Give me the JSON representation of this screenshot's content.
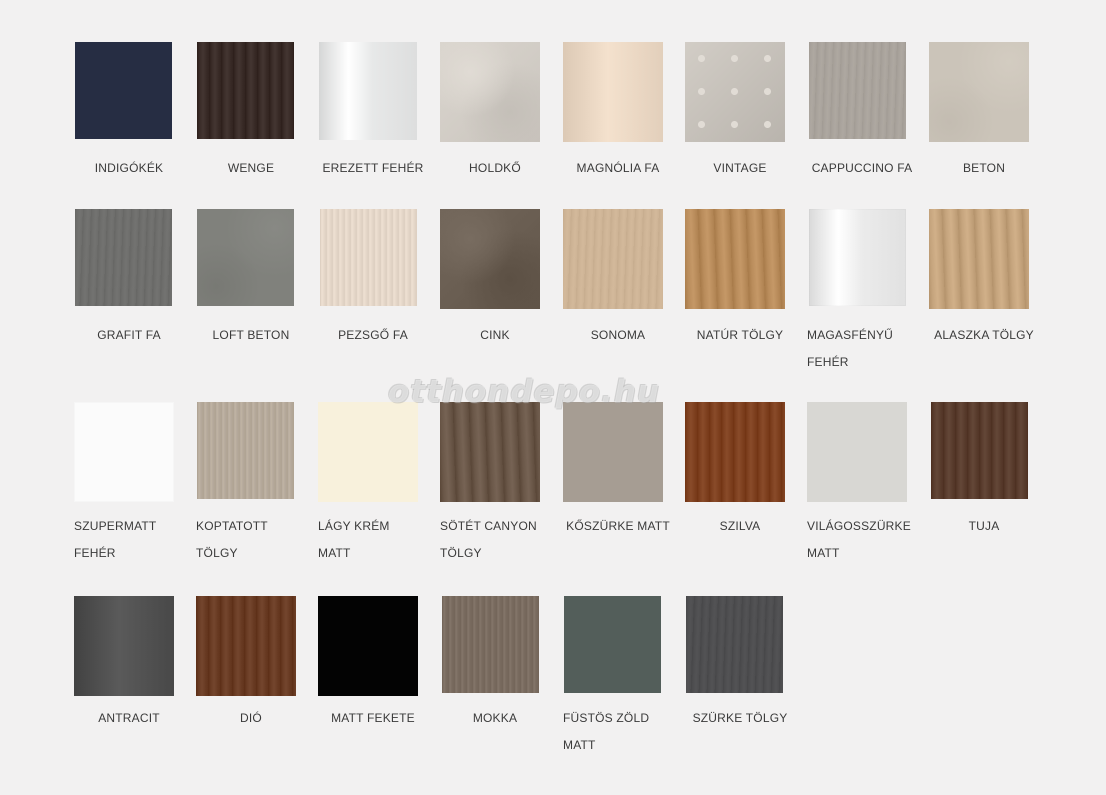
{
  "watermark": "otthondepo.hu",
  "swatches": [
    {
      "label": "INDIGÓKÉK",
      "color": "#262d43",
      "texture": "solid"
    },
    {
      "label": "WENGE",
      "color": "#3a2c28",
      "texture": "woodDark"
    },
    {
      "label": "EREZETT FEHÉR",
      "color": "#e7e8e8",
      "texture": "gloss"
    },
    {
      "label": "HOLDKŐ",
      "color": "#d2cdc6",
      "texture": "marble"
    },
    {
      "label": "MAGNÓLIA FA",
      "color": "#e8d5c1",
      "texture": "smooth"
    },
    {
      "label": "VINTAGE",
      "color": "#c8c3bc",
      "texture": "pattern"
    },
    {
      "label": "CAPPUCCINO FA",
      "color": "#a8a29b",
      "texture": "woodLight"
    },
    {
      "label": "BETON",
      "color": "#cbc4b9",
      "texture": "concrete"
    },
    {
      "label": "GRAFIT FA",
      "color": "#6d6d6b",
      "texture": "woodLight"
    },
    {
      "label": "LOFT BETON",
      "color": "#80817c",
      "texture": "concrete"
    },
    {
      "label": "PEZSGŐ FA",
      "color": "#e5d7c9",
      "texture": "woodStripe"
    },
    {
      "label": "CINK",
      "color": "#6a5e52",
      "texture": "marble"
    },
    {
      "label": "SONOMA",
      "color": "#cdb395",
      "texture": "woodLight"
    },
    {
      "label": "NATÚR TÖLGY",
      "color": "#b98c5b",
      "texture": "woodGrain"
    },
    {
      "label": "MAGASFÉNYŰ\nFEHÉR",
      "color": "#ebebeb",
      "texture": "gloss"
    },
    {
      "label": "ALASZKA TÖLGY",
      "color": "#c5a47d",
      "texture": "woodGrain"
    },
    {
      "label": "SZUPERMATT\nFEHÉR",
      "color": "#fbfbfb",
      "texture": "solid"
    },
    {
      "label": "KOPTATOTT\nTÖLGY",
      "color": "#b6aa9b",
      "texture": "woodStripe"
    },
    {
      "label": "LÁGY KRÉM\nMATT",
      "color": "#f8f1dc",
      "texture": "solid"
    },
    {
      "label": "SÖTÉT CANYON\nTÖLGY",
      "color": "#6a5748",
      "texture": "woodGrain"
    },
    {
      "label": "KŐSZÜRKE MATT",
      "color": "#a69d93",
      "texture": "solid"
    },
    {
      "label": "SZILVA",
      "color": "#7f4120",
      "texture": "woodDark"
    },
    {
      "label": "VILÁGOSSZÜRKE\nMATT",
      "color": "#d8d7d3",
      "texture": "solid"
    },
    {
      "label": "TUJA",
      "color": "#5a3d2e",
      "texture": "woodDark"
    },
    {
      "label": "ANTRACIT",
      "color": "#4e4e4e",
      "texture": "smooth"
    },
    {
      "label": "DIÓ",
      "color": "#6a3c24",
      "texture": "woodDark"
    },
    {
      "label": "MATT FEKETE",
      "color": "#030303",
      "texture": "solid"
    },
    {
      "label": "MOKKA",
      "color": "#7a6c60",
      "texture": "woodStripe"
    },
    {
      "label": "FÜSTÖS ZÖLD\nMATT",
      "color": "#535e5a",
      "texture": "solid"
    },
    {
      "label": "SZÜRKE TÖLGY",
      "color": "#4d4d4f",
      "texture": "woodLight"
    }
  ]
}
